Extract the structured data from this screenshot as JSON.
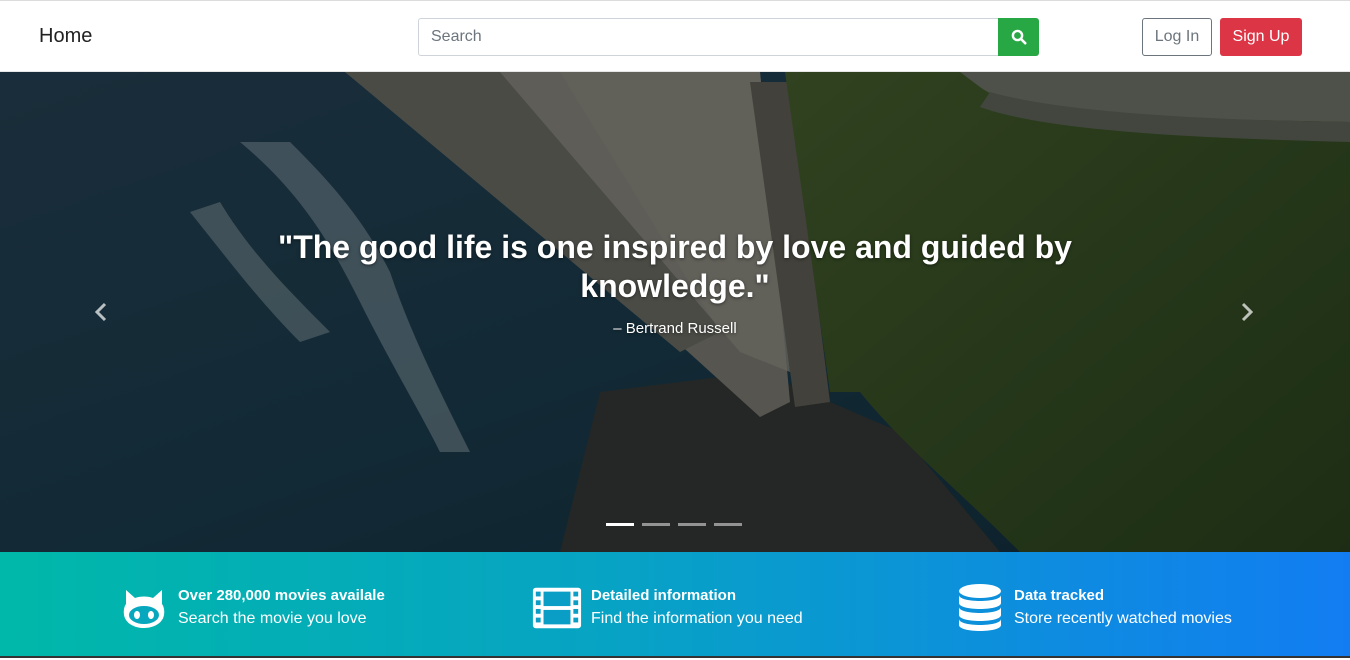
{
  "nav": {
    "brand": "Home",
    "search_placeholder": "Search",
    "search_icon": "search-icon",
    "login_label": "Log In",
    "signup_label": "Sign Up"
  },
  "carousel": {
    "quote": "\"The good life is one inspired by love and guided by knowledge.\"",
    "author": "– Bertrand Russell",
    "prev_icon": "chevron-left-icon",
    "next_icon": "chevron-right-icon",
    "indicator_count": 4,
    "active_index": 0
  },
  "features": [
    {
      "icon": "github-icon",
      "title": "Over 280,000 movies availale",
      "desc": "Search the movie you love"
    },
    {
      "icon": "film-icon",
      "title": "Detailed information",
      "desc": "Find the information you need"
    },
    {
      "icon": "database-icon",
      "title": "Data tracked",
      "desc": "Store recently watched movies"
    }
  ],
  "colors": {
    "search_button": "#28a745",
    "signup_button": "#dc3545",
    "gradient_start": "#00b8a9",
    "gradient_end": "#127df2"
  }
}
